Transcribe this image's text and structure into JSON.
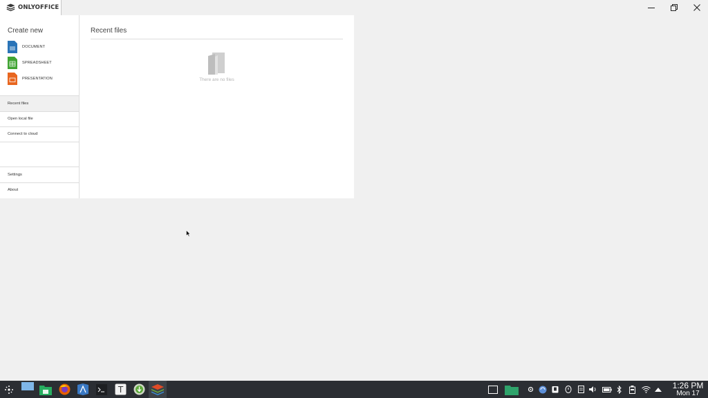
{
  "app": {
    "brand": "ONLYOFFICE"
  },
  "sidebar": {
    "create_title": "Create new",
    "create_items": [
      {
        "label": "DOCUMENT",
        "color": "#2a74b8"
      },
      {
        "label": "SPREADSHEET",
        "color": "#40a433"
      },
      {
        "label": "PRESENTATION",
        "color": "#e8661f"
      }
    ],
    "nav": [
      {
        "label": "Recent files",
        "active": true
      },
      {
        "label": "Open local file"
      },
      {
        "label": "Connect to cloud"
      }
    ],
    "bottom_nav": [
      {
        "label": "Settings"
      },
      {
        "label": "About"
      }
    ]
  },
  "main": {
    "title": "Recent files",
    "empty_text": "There are no files"
  },
  "taskbar": {
    "apps": [
      {
        "icon": "application-launcher-icon"
      },
      {
        "icon": "desktop-pager-icon"
      },
      {
        "icon": "file-manager-icon"
      },
      {
        "icon": "firefox-icon"
      },
      {
        "icon": "app-store-icon"
      },
      {
        "icon": "terminal-icon"
      },
      {
        "icon": "text-editor-icon"
      },
      {
        "icon": "download-manager-icon"
      },
      {
        "icon": "onlyoffice-icon",
        "active": true
      }
    ],
    "tray": [
      "screen-icon",
      "folder-icon",
      "settings-icon",
      "sync-icon",
      "clipboard-icon",
      "vault-icon",
      "notes-icon",
      "volume-icon",
      "battery-icon",
      "bluetooth-icon",
      "storage-icon",
      "wifi-icon",
      "expand-arrow-icon"
    ],
    "clock": {
      "time": "1:26 PM",
      "date": "Mon 17"
    }
  }
}
